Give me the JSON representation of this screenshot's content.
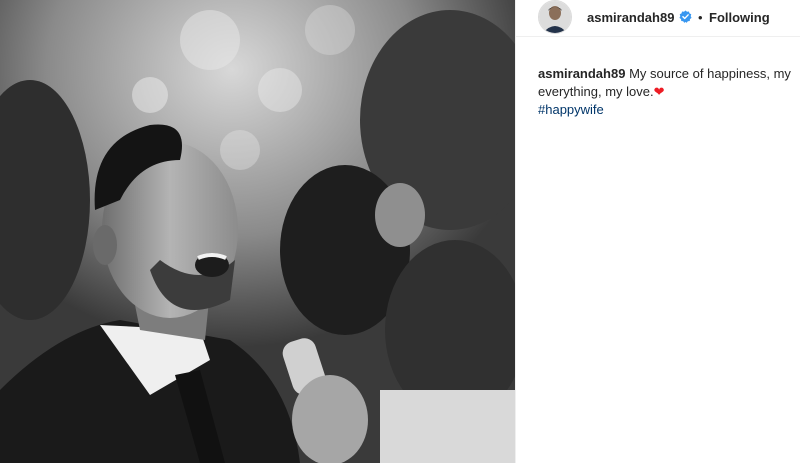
{
  "post": {
    "username": "asmirandah89",
    "separator": "•",
    "follow_status": "Following",
    "caption_user": "asmirandah89",
    "caption_text": "My source of happiness, my everything, my love.",
    "caption_emoji": "❤",
    "hashtag": "#happywife"
  },
  "icons": {
    "verified": "verified-badge-icon",
    "avatar": "profile-avatar"
  },
  "colors": {
    "link": "#003569",
    "verified": "#3897f0",
    "heart": "#ed1c24",
    "text": "#262626"
  }
}
